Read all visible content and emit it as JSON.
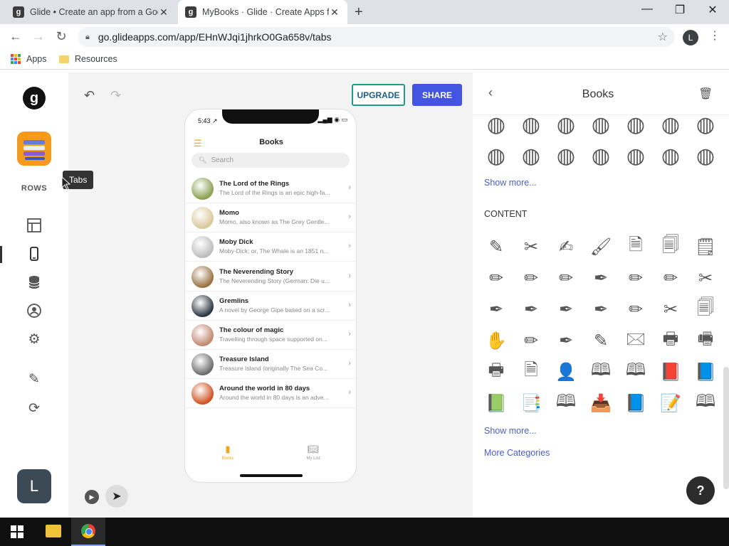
{
  "browser": {
    "tabs": [
      {
        "favicon": "g",
        "title": "Glide • Create an app from a Goo",
        "close": "✕"
      },
      {
        "favicon": "g",
        "title": "MyBooks · Glide · Create Apps fro",
        "close": "✕"
      }
    ],
    "new_tab": "+",
    "window_controls": {
      "minimize": "—",
      "maximize": "❐",
      "close": "✕"
    },
    "url": "go.glideapps.com/app/EHnWJqi1jhrkO0Ga658v/tabs",
    "profile_initial": "L",
    "bookmarks": [
      {
        "label": "Apps",
        "icon": "apps-grid-icon"
      },
      {
        "label": "Resources",
        "icon": "folder-icon"
      }
    ]
  },
  "left_rail": {
    "logo": "g",
    "rows_label": "ROWS",
    "user_initial": "L",
    "tooltip": "Tabs"
  },
  "canvas": {
    "upgrade_label": "UPGRADE",
    "share_label": "SHARE"
  },
  "phone": {
    "time": "5:43 ↗",
    "status": "▂▄▆ ◉ ▭",
    "title": "Books",
    "search_placeholder": "Search",
    "books": [
      {
        "title": "The Lord of the Rings",
        "subtitle": "The Lord of the Rings is an epic high-fa...",
        "color": "#8aa050"
      },
      {
        "title": "Momo",
        "subtitle": "Momo, also known as The Grey Gentle...",
        "color": "#d9c89a"
      },
      {
        "title": "Moby Dick",
        "subtitle": "Moby-Dick; or, The Whale is an 1851 n...",
        "color": "#bdbdbd"
      },
      {
        "title": "The Neverending Story",
        "subtitle": "The Neverending Story (German: Die u...",
        "color": "#9a7040"
      },
      {
        "title": "Gremlins",
        "subtitle": "A novel by George Gipe based on a scr...",
        "color": "#2c3440"
      },
      {
        "title": "The colour of magic",
        "subtitle": "Travelling through space supported on...",
        "color": "#c08870"
      },
      {
        "title": "Treasure Island",
        "subtitle": "Treasure Island (originally The Sea Co...",
        "color": "#6a6a6a"
      },
      {
        "title": "Around the world in 80 days",
        "subtitle": "Around the world in 80 days is an adve...",
        "color": "#d05020"
      }
    ],
    "tabs": [
      {
        "label": "Books",
        "color": "#f0a818"
      },
      {
        "label": "My List",
        "color": "#999999"
      }
    ]
  },
  "panel": {
    "title": "Books",
    "show_more_1": "Show more...",
    "content_title": "CONTENT",
    "show_more_2": "Show more...",
    "more_categories": "More Categories"
  },
  "help_label": "?"
}
